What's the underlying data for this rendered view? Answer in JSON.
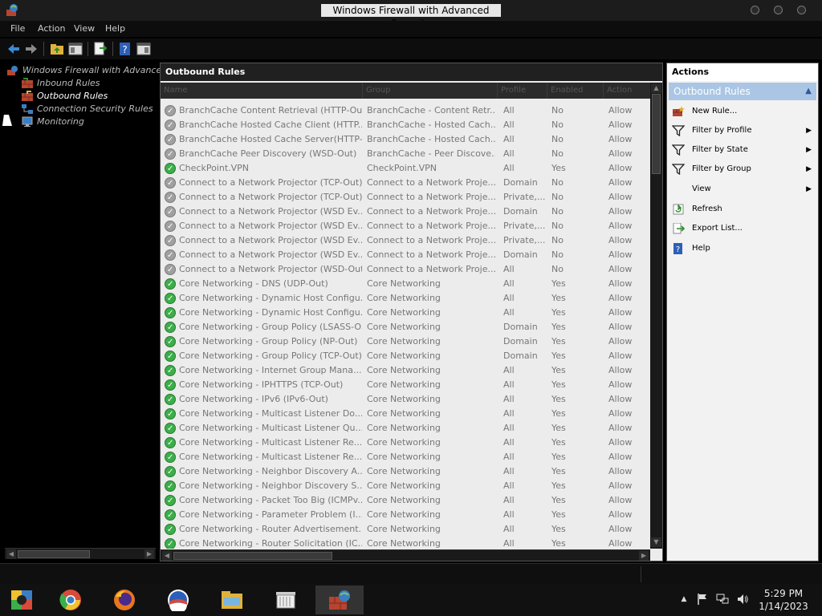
{
  "window": {
    "title": "Windows Firewall with Advanced Security"
  },
  "menu": [
    "File",
    "Action",
    "View",
    "Help"
  ],
  "tree": {
    "root": "Windows Firewall with Advanced",
    "items": [
      "Inbound Rules",
      "Outbound Rules",
      "Connection Security Rules",
      "Monitoring"
    ],
    "selected": "Outbound Rules"
  },
  "center": {
    "title": "Outbound Rules",
    "columns": [
      "Name",
      "Group",
      "Profile",
      "Enabled",
      "Action"
    ],
    "rows": [
      {
        "name": "BranchCache Content Retrieval (HTTP-Out)",
        "group": "BranchCache - Content Retr...",
        "profile": "All",
        "enabled": "No",
        "action": "Allow"
      },
      {
        "name": "BranchCache Hosted Cache Client (HTTP...",
        "group": "BranchCache - Hosted Cach...",
        "profile": "All",
        "enabled": "No",
        "action": "Allow"
      },
      {
        "name": "BranchCache Hosted Cache Server(HTTP-...",
        "group": "BranchCache - Hosted Cach...",
        "profile": "All",
        "enabled": "No",
        "action": "Allow"
      },
      {
        "name": "BranchCache Peer Discovery (WSD-Out)",
        "group": "BranchCache - Peer Discove...",
        "profile": "All",
        "enabled": "No",
        "action": "Allow"
      },
      {
        "name": "CheckPoint.VPN",
        "group": "CheckPoint.VPN",
        "profile": "All",
        "enabled": "Yes",
        "action": "Allow"
      },
      {
        "name": "Connect to a Network Projector (TCP-Out)",
        "group": "Connect to a Network Proje...",
        "profile": "Domain",
        "enabled": "No",
        "action": "Allow"
      },
      {
        "name": "Connect to a Network Projector (TCP-Out)",
        "group": "Connect to a Network Proje...",
        "profile": "Private,...",
        "enabled": "No",
        "action": "Allow"
      },
      {
        "name": "Connect to a Network Projector (WSD Ev...",
        "group": "Connect to a Network Proje...",
        "profile": "Domain",
        "enabled": "No",
        "action": "Allow"
      },
      {
        "name": "Connect to a Network Projector (WSD Ev...",
        "group": "Connect to a Network Proje...",
        "profile": "Private,...",
        "enabled": "No",
        "action": "Allow"
      },
      {
        "name": "Connect to a Network Projector (WSD Ev...",
        "group": "Connect to a Network Proje...",
        "profile": "Private,...",
        "enabled": "No",
        "action": "Allow"
      },
      {
        "name": "Connect to a Network Projector (WSD Ev...",
        "group": "Connect to a Network Proje...",
        "profile": "Domain",
        "enabled": "No",
        "action": "Allow"
      },
      {
        "name": "Connect to a Network Projector (WSD-Out)",
        "group": "Connect to a Network Proje...",
        "profile": "All",
        "enabled": "No",
        "action": "Allow"
      },
      {
        "name": "Core Networking - DNS (UDP-Out)",
        "group": "Core Networking",
        "profile": "All",
        "enabled": "Yes",
        "action": "Allow"
      },
      {
        "name": "Core Networking - Dynamic Host Configu...",
        "group": "Core Networking",
        "profile": "All",
        "enabled": "Yes",
        "action": "Allow"
      },
      {
        "name": "Core Networking - Dynamic Host Configu...",
        "group": "Core Networking",
        "profile": "All",
        "enabled": "Yes",
        "action": "Allow"
      },
      {
        "name": "Core Networking - Group Policy (LSASS-O...",
        "group": "Core Networking",
        "profile": "Domain",
        "enabled": "Yes",
        "action": "Allow"
      },
      {
        "name": "Core Networking - Group Policy (NP-Out)",
        "group": "Core Networking",
        "profile": "Domain",
        "enabled": "Yes",
        "action": "Allow"
      },
      {
        "name": "Core Networking - Group Policy (TCP-Out)",
        "group": "Core Networking",
        "profile": "Domain",
        "enabled": "Yes",
        "action": "Allow"
      },
      {
        "name": "Core Networking - Internet Group Mana...",
        "group": "Core Networking",
        "profile": "All",
        "enabled": "Yes",
        "action": "Allow"
      },
      {
        "name": "Core Networking - IPHTTPS (TCP-Out)",
        "group": "Core Networking",
        "profile": "All",
        "enabled": "Yes",
        "action": "Allow"
      },
      {
        "name": "Core Networking - IPv6 (IPv6-Out)",
        "group": "Core Networking",
        "profile": "All",
        "enabled": "Yes",
        "action": "Allow"
      },
      {
        "name": "Core Networking - Multicast Listener Do...",
        "group": "Core Networking",
        "profile": "All",
        "enabled": "Yes",
        "action": "Allow"
      },
      {
        "name": "Core Networking - Multicast Listener Qu...",
        "group": "Core Networking",
        "profile": "All",
        "enabled": "Yes",
        "action": "Allow"
      },
      {
        "name": "Core Networking - Multicast Listener Re...",
        "group": "Core Networking",
        "profile": "All",
        "enabled": "Yes",
        "action": "Allow"
      },
      {
        "name": "Core Networking - Multicast Listener Re...",
        "group": "Core Networking",
        "profile": "All",
        "enabled": "Yes",
        "action": "Allow"
      },
      {
        "name": "Core Networking - Neighbor Discovery A...",
        "group": "Core Networking",
        "profile": "All",
        "enabled": "Yes",
        "action": "Allow"
      },
      {
        "name": "Core Networking - Neighbor Discovery S...",
        "group": "Core Networking",
        "profile": "All",
        "enabled": "Yes",
        "action": "Allow"
      },
      {
        "name": "Core Networking - Packet Too Big (ICMPv...",
        "group": "Core Networking",
        "profile": "All",
        "enabled": "Yes",
        "action": "Allow"
      },
      {
        "name": "Core Networking - Parameter Problem (I...",
        "group": "Core Networking",
        "profile": "All",
        "enabled": "Yes",
        "action": "Allow"
      },
      {
        "name": "Core Networking - Router Advertisement...",
        "group": "Core Networking",
        "profile": "All",
        "enabled": "Yes",
        "action": "Allow"
      },
      {
        "name": "Core Networking - Router Solicitation (IC...",
        "group": "Core Networking",
        "profile": "All",
        "enabled": "Yes",
        "action": "Allow"
      }
    ]
  },
  "actions": {
    "title": "Actions",
    "section": "Outbound Rules",
    "items": [
      {
        "label": "New Rule...",
        "icon": "new-rule-icon",
        "submenu": false
      },
      {
        "label": "Filter by Profile",
        "icon": "filter-icon",
        "submenu": true
      },
      {
        "label": "Filter by State",
        "icon": "filter-icon",
        "submenu": true
      },
      {
        "label": "Filter by Group",
        "icon": "filter-icon",
        "submenu": true
      },
      {
        "label": "View",
        "icon": "",
        "submenu": true
      },
      {
        "label": "Refresh",
        "icon": "refresh-icon",
        "submenu": false
      },
      {
        "label": "Export List...",
        "icon": "export-icon",
        "submenu": false
      },
      {
        "label": "Help",
        "icon": "help-icon",
        "submenu": false
      }
    ]
  },
  "clock": {
    "time": "5:29 PM",
    "date": "1/14/2023"
  },
  "colors": {
    "enabled": "#3cae4a",
    "disabled": "#a0a0a0",
    "actions_section": "#aac6e4"
  }
}
